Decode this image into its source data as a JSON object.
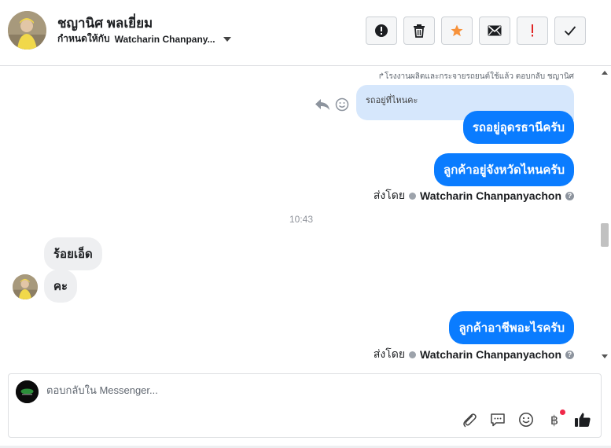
{
  "header": {
    "contact_name": "ชญานิศ พลเยี่ยม",
    "assign_prefix": "กำหนดให้กับ",
    "assignee": "Watcharin Chanpany..."
  },
  "toolbar": {
    "buttons": [
      {
        "icon": "alert-circle-icon",
        "label": "Mark as spam"
      },
      {
        "icon": "trash-icon",
        "label": "Delete"
      },
      {
        "icon": "star-icon",
        "label": "Star",
        "color": "#f7923b"
      },
      {
        "icon": "envelope-icon",
        "label": "Mark as unread"
      },
      {
        "icon": "exclamation-icon",
        "label": "Follow up",
        "color": "#e02424"
      },
      {
        "icon": "check-icon",
        "label": "Done"
      }
    ]
  },
  "thread": {
    "reply_context": "โรงงานผลิตและกระจายรถยนต์ใช้แล้ว ตอบกลับ ชญานิศ",
    "quoted_text": "รถอยู่ที่ไหนคะ",
    "messages": [
      {
        "direction": "out",
        "text": "รถอยู่อุดรธานีครับ"
      },
      {
        "direction": "out",
        "text": "ลูกค้าอยู่จังหวัดไหนครับ"
      },
      {
        "direction": "in",
        "text": "ร้อยเอ็ด"
      },
      {
        "direction": "in",
        "text": "คะ"
      },
      {
        "direction": "out",
        "text": "ลูกค้าอาชีพอะไรครับ"
      }
    ],
    "sent_by_label": "ส่งโดย",
    "sent_by_agent": "Watcharin Chanpanyachon",
    "timestamp": "10:43"
  },
  "composer": {
    "placeholder": "ตอบกลับใน Messenger...",
    "tools": [
      "paperclip-icon",
      "saved-reply-icon",
      "emoji-icon",
      "baht-payment-icon",
      "thumbs-up-icon"
    ],
    "baht_symbol": "฿",
    "accent": "#0a7cff"
  }
}
